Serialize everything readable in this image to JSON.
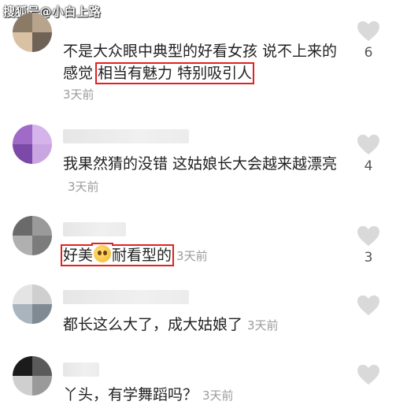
{
  "watermark": "搜狐号@小白上路",
  "comments": [
    {
      "text_plain": "不是大众眼中典型的好看女孩 说不上来的感觉 ",
      "text_highlight": "相当有魅力 特别吸引人",
      "time": "3天前",
      "likes": "6"
    },
    {
      "text_plain": "我果然猜的没错 这姑娘长大会越来越漂亮",
      "time": "3天前",
      "likes": "4"
    },
    {
      "text_before": "好美",
      "emoji_icon": "pleading-face-emoji",
      "text_after": "耐看型的",
      "time": "3天前",
      "likes": "3"
    },
    {
      "text_plain": "都长这么大了，成大姑娘了",
      "time": "3天前",
      "likes": ""
    },
    {
      "text_plain": "丫头，有学舞蹈吗？",
      "time": "3天前",
      "likes": ""
    }
  ],
  "colors": {
    "highlight_box": "#e32020",
    "heart": "#d9d9d9",
    "time": "#9b9b9b"
  }
}
